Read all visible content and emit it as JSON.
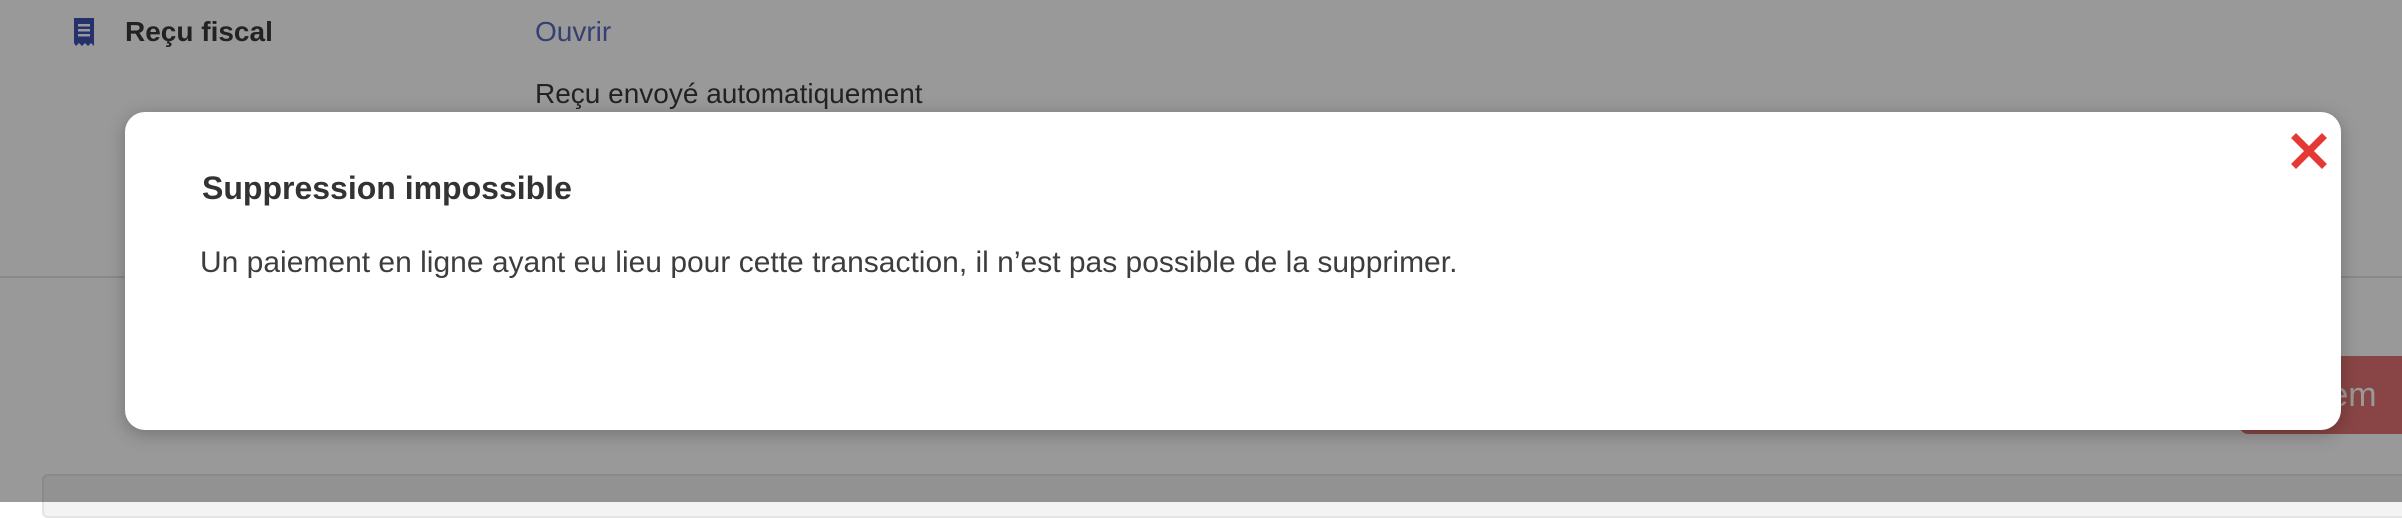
{
  "receipt": {
    "label": "Reçu fiscal",
    "open_link": "Ouvrir",
    "status_text": "Reçu envoyé automatiquement",
    "icon": "document-icon"
  },
  "background_button": {
    "visible_text": "rem"
  },
  "modal": {
    "title": "Suppression impossible",
    "message": "Un paiement en ligne ayant eu lieu pour cette transaction, il n’est pas possible de la supprimer.",
    "close_icon": "close-icon",
    "close_color": "#e53935"
  },
  "colors": {
    "link": "#5c6bc0",
    "icon": "#3f51b5",
    "danger_button": "#e57373"
  }
}
